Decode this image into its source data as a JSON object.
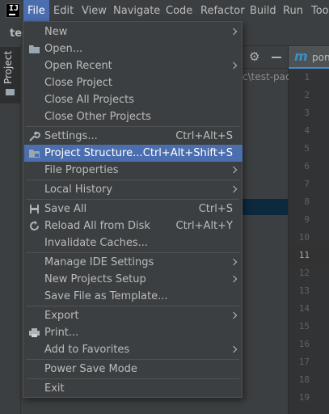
{
  "menubar": {
    "items": [
      "File",
      "Edit",
      "View",
      "Navigate",
      "Code",
      "Refactor",
      "Build",
      "Run",
      "Tools"
    ]
  },
  "project": {
    "name_fragment": "tes",
    "tool_window_label": "Project",
    "path_fragment": "c\\test-pac"
  },
  "editor": {
    "tab_fragment": "pon",
    "line_numbers": [
      "1",
      "2",
      "3",
      "4",
      "5",
      "6",
      "7",
      "8",
      "9",
      "10",
      "11",
      "12",
      "13",
      "14",
      "15",
      "16",
      "17",
      "18",
      "19"
    ],
    "current_line": "11"
  },
  "file_menu": {
    "new": "New",
    "open": "Open...",
    "open_recent": "Open Recent",
    "close_project": "Close Project",
    "close_all_projects": "Close All Projects",
    "close_other_projects": "Close Other Projects",
    "settings": "Settings...",
    "settings_shortcut": "Ctrl+Alt+S",
    "project_structure": "Project Structure...",
    "project_structure_shortcut": "Ctrl+Alt+Shift+S",
    "file_properties": "File Properties",
    "local_history": "Local History",
    "save_all": "Save All",
    "save_all_shortcut": "Ctrl+S",
    "reload_all": "Reload All from Disk",
    "reload_all_shortcut": "Ctrl+Alt+Y",
    "invalidate_caches": "Invalidate Caches...",
    "manage_ide_settings": "Manage IDE Settings",
    "new_projects_setup": "New Projects Setup",
    "save_file_as_template": "Save File as Template...",
    "export": "Export",
    "print": "Print...",
    "add_to_favorites": "Add to Favorites",
    "power_save_mode": "Power Save Mode",
    "exit": "Exit"
  },
  "colors": {
    "accent": "#4b6eaf",
    "menu_bg": "#3c3f41",
    "editor_bg": "#2b2b2b"
  }
}
